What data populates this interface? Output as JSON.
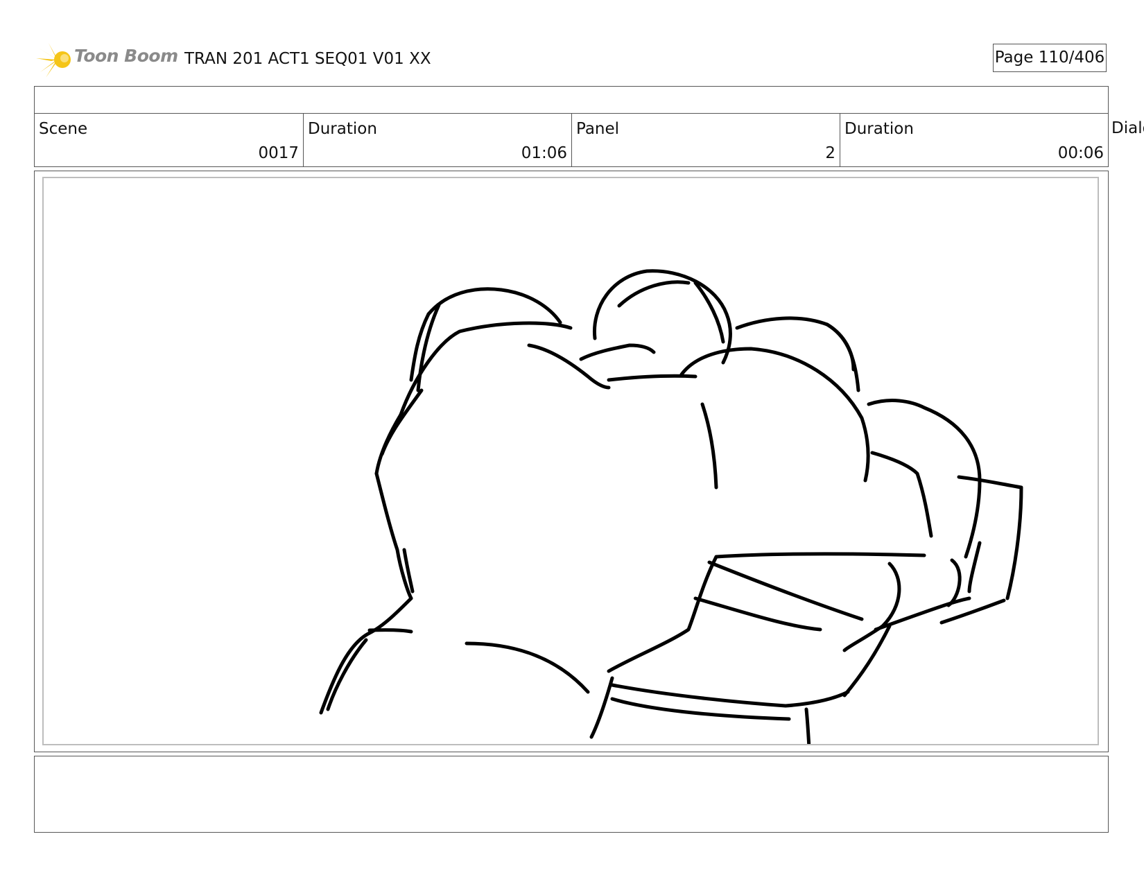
{
  "header": {
    "logo_text": "Toon Boom",
    "title": "TRAN 201 ACT1 SEQ01 V01 XX",
    "page_label": "Page 110/406"
  },
  "info": {
    "scene_label": "Scene",
    "scene_value": "0017",
    "scene_duration_label": "Duration",
    "scene_duration_value": "01:06",
    "panel_label": "Panel",
    "panel_value": "2",
    "panel_duration_label": "Duration",
    "panel_duration_value": "00:06",
    "dialog_label": "Dialog"
  },
  "colors": {
    "logo_accent": "#f5c518",
    "border": "#555555",
    "frame": "#bdbdbd",
    "ink": "#000000"
  },
  "icons": [
    "toon-boom-logo-icon"
  ]
}
